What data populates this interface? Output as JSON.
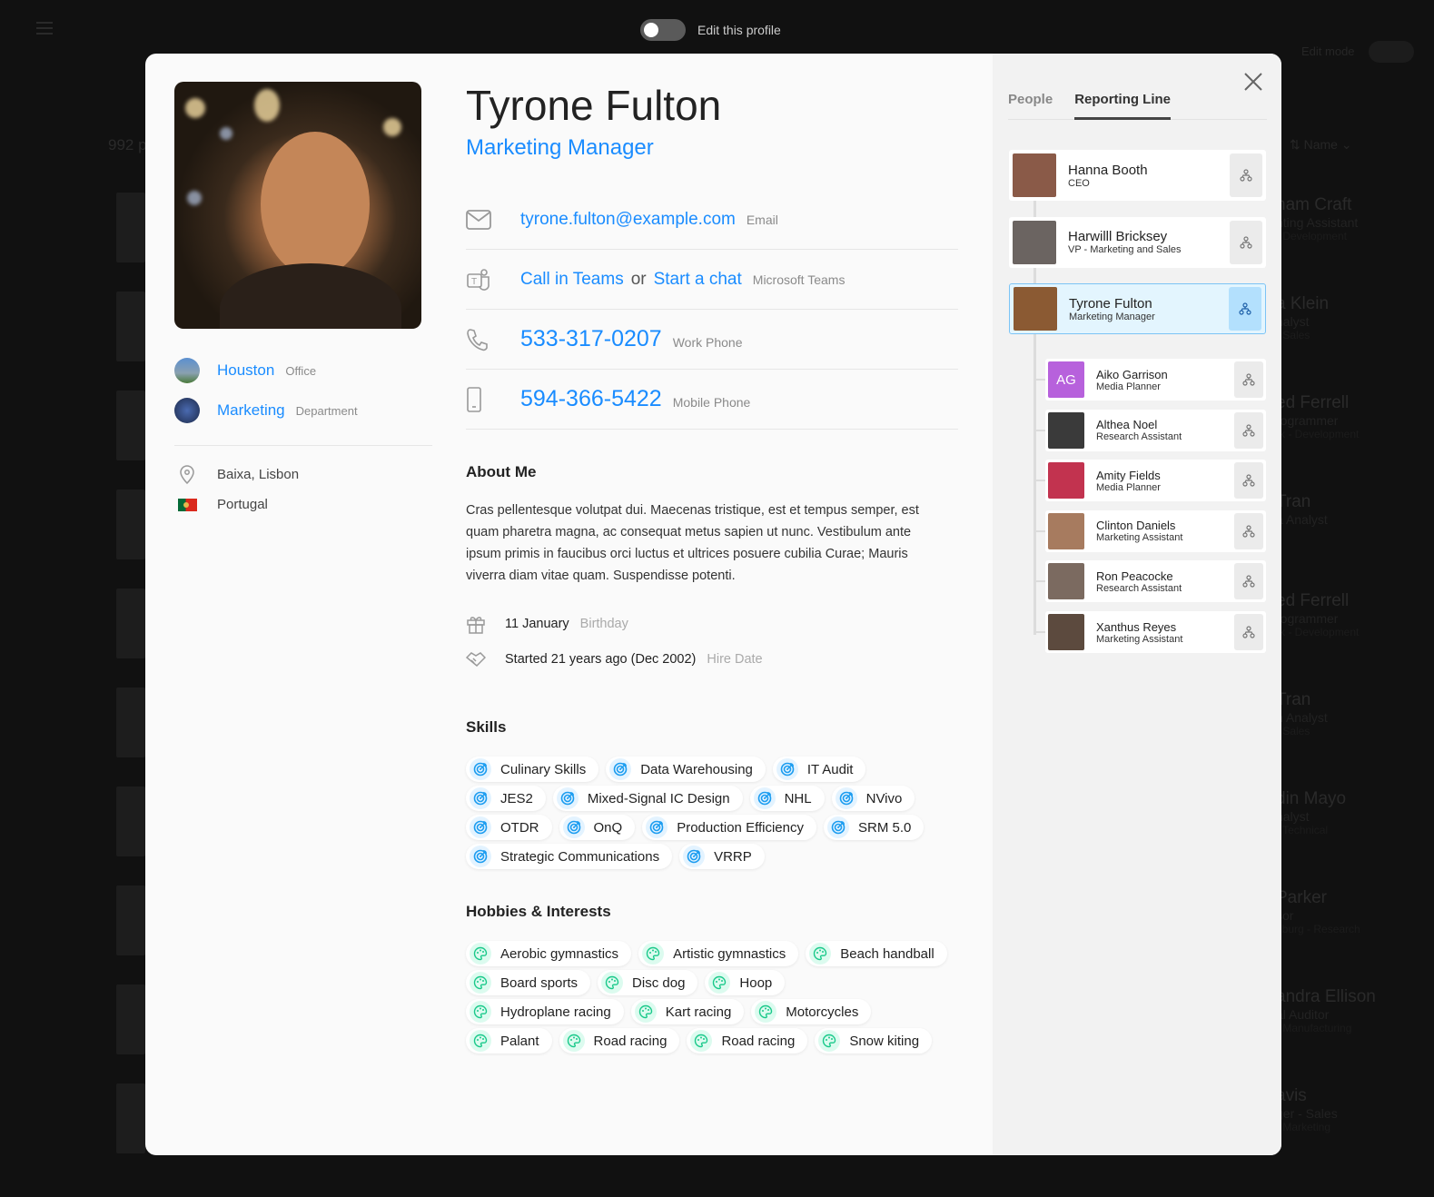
{
  "topbar": {
    "edit_profile_label": "Edit this profile",
    "edit_profile_on": false
  },
  "background": {
    "count_text": "992 p",
    "edit_mode_label": "Edit mode",
    "sort_label": "Name",
    "items": [
      {
        "name": "ham Craft",
        "role": "nting Assistant",
        "dept": "- Development"
      },
      {
        "name": "a Klein",
        "role": "nalyst",
        "dept": "- Sales"
      },
      {
        "name": "ed Ferrell",
        "role": "rogrammer",
        "dept": "rk - Development"
      },
      {
        "name": "Tran",
        "role": "a Analyst",
        "dept": ""
      },
      {
        "name": "ed Ferrell",
        "role": "rogrammer",
        "dept": "rk - Development"
      },
      {
        "name": "Tran",
        "role": "n Analyst",
        "dept": "- Sales"
      },
      {
        "name": "din Mayo",
        "role": "nalyst",
        "dept": "- Technical"
      },
      {
        "name": "Parker",
        "role": "sor",
        "dept": "eburg - Research"
      },
      {
        "name": "andra Ellison",
        "role": "al Auditor",
        "dept": "- Manufacturing"
      },
      {
        "name": "avis",
        "role": "ger - Sales",
        "dept": "- Marketing"
      }
    ]
  },
  "profile": {
    "name": "Tyrone Fulton",
    "title": "Marketing Manager",
    "office": {
      "value": "Houston",
      "label": "Office"
    },
    "department": {
      "value": "Marketing",
      "label": "Department"
    },
    "location": "Baixa, Lisbon",
    "country": "Portugal",
    "email": {
      "value": "tyrone.fulton@example.com",
      "label": "Email"
    },
    "teams": {
      "call": "Call in Teams",
      "or": "or",
      "chat": "Start a chat",
      "label": "Microsoft Teams"
    },
    "work_phone": {
      "value": "533-317-0207",
      "label": "Work Phone"
    },
    "mobile_phone": {
      "value": "594-366-5422",
      "label": "Mobile Phone"
    },
    "about_heading": "About Me",
    "about": "Cras pellentesque volutpat dui. Maecenas tristique, est et tempus semper, est quam pharetra magna, ac consequat metus sapien ut nunc. Vestibulum ante ipsum primis in faucibus orci luctus et ultrices posuere cubilia Curae; Mauris viverra diam vitae quam. Suspendisse potenti.",
    "birthday": {
      "value": "11 January",
      "label": "Birthday"
    },
    "hire": {
      "value": "Started 21 years ago (Dec 2002)",
      "label": "Hire Date"
    },
    "skills_heading": "Skills",
    "skills": [
      "Culinary Skills",
      "Data Warehousing",
      "IT Audit",
      "JES2",
      "Mixed-Signal IC Design",
      "NHL",
      "NVivo",
      "OTDR",
      "OnQ",
      "Production Efficiency",
      "SRM 5.0",
      "Strategic Communications",
      "VRRP"
    ],
    "hobbies_heading": "Hobbies & Interests",
    "hobbies": [
      "Aerobic gymnastics",
      "Artistic gymnastics",
      "Beach handball",
      "Board sports",
      "Disc dog",
      "Hoop",
      "Hydroplane racing",
      "Kart racing",
      "Motorcycles",
      "Palant",
      "Road racing",
      "Road racing",
      "Snow kiting"
    ]
  },
  "side": {
    "tabs": [
      {
        "label": "People",
        "active": false
      },
      {
        "label": "Reporting Line",
        "active": true
      }
    ],
    "chain": [
      {
        "name": "Hanna Booth",
        "title": "CEO",
        "avatar": "#8a5a48"
      },
      {
        "name": "Harwilll Bricksey",
        "title": "VP - Marketing and Sales",
        "avatar": "#6b6461"
      },
      {
        "name": "Tyrone Fulton",
        "title": "Marketing Manager",
        "avatar": "#8b5a33",
        "selected": true
      }
    ],
    "reports": [
      {
        "name": "Aiko Garrison",
        "title": "Media Planner",
        "initials": "AG",
        "avatar": "#b761dc"
      },
      {
        "name": "Althea Noel",
        "title": "Research Assistant",
        "avatar": "#3a3a3a"
      },
      {
        "name": "Amity Fields",
        "title": "Media Planner",
        "avatar": "#c2334f"
      },
      {
        "name": "Clinton Daniels",
        "title": "Marketing Assistant",
        "avatar": "#a77b5f"
      },
      {
        "name": "Ron Peacocke",
        "title": "Research Assistant",
        "avatar": "#7b6a60"
      },
      {
        "name": "Xanthus Reyes",
        "title": "Marketing Assistant",
        "avatar": "#5c4a3e"
      }
    ]
  },
  "colors": {
    "accent": "#1a8cff",
    "skill_icon": "#1a9cf0",
    "hobby_icon": "#19c98a",
    "selected_bg": "#e3f5fe"
  }
}
